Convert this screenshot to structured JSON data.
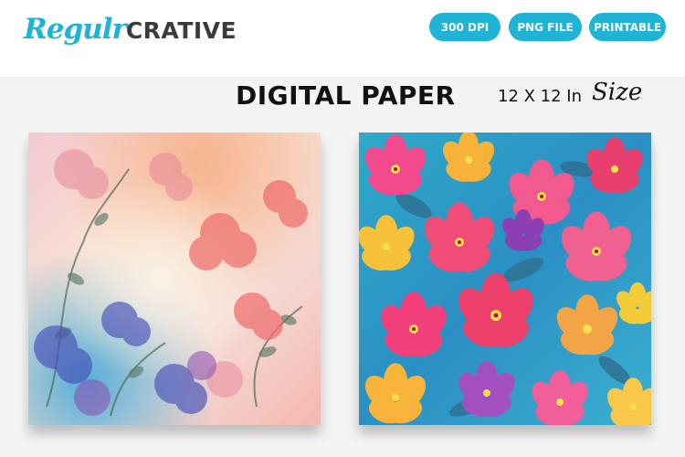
{
  "brand": {
    "script": "Regulr",
    "block": "CRATIVE"
  },
  "badges": [
    "300 DPI",
    "PNG FILE",
    "PRINTABLE"
  ],
  "title": "DIGITAL PAPER",
  "size_label": "12 X 12 In",
  "size_script": "Size",
  "colors": {
    "accent": "#1fb3d6",
    "logo_dark": "#3b3b3b",
    "text": "#111111",
    "background": "#f4f4f4"
  },
  "papers": [
    {
      "name": "watercolor-floral-paper"
    },
    {
      "name": "bright-tropical-floral-paper"
    }
  ]
}
